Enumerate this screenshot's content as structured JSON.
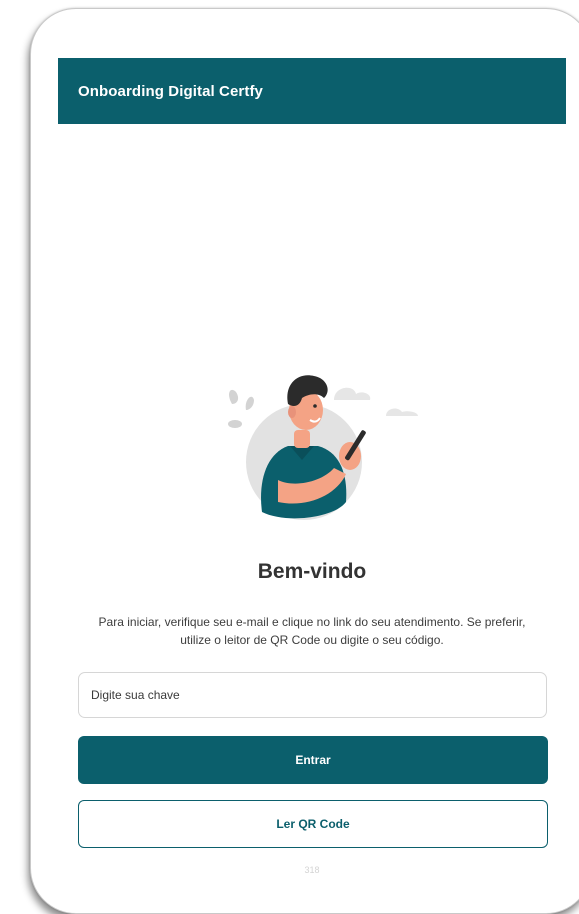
{
  "app": {
    "title": "Onboarding Digital Certfy"
  },
  "illustration": {
    "name": "man-with-phone-illustration"
  },
  "welcome": {
    "heading": "Bem-vindo",
    "text": "Para iniciar, verifique seu e-mail e clique no link do seu atendimento. Se preferir, utilize o leitor de QR Code ou digite o seu código."
  },
  "form": {
    "key_placeholder": "Digite sua chave",
    "enter_label": "Entrar",
    "qr_label": "Ler QR Code"
  },
  "footer": {
    "version": "318"
  },
  "colors": {
    "primary": "#0b5f6c",
    "text": "#333333",
    "skin": "#f4a385",
    "shirt": "#0b5f6c"
  }
}
